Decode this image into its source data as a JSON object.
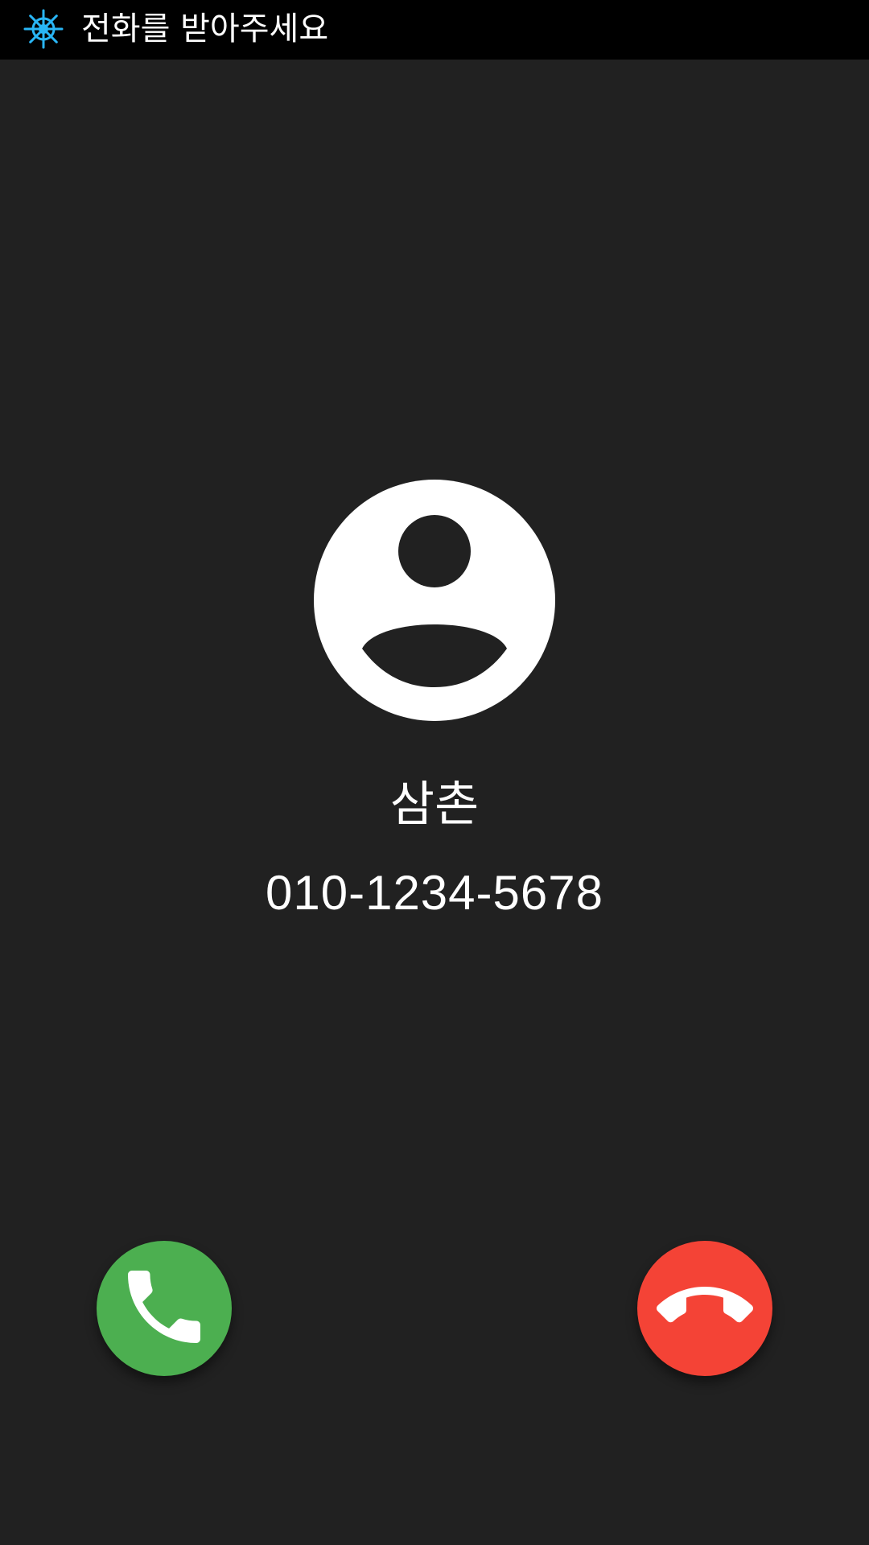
{
  "app": {
    "title": "전화를 받아주세요",
    "icon": "ship-wheel-icon",
    "icon_color": "#29b6f6"
  },
  "caller": {
    "name": "삼촌",
    "number": "010-1234-5678",
    "avatar_icon": "account-circle-icon"
  },
  "actions": {
    "accept": {
      "icon": "phone-icon",
      "color": "#4caf50"
    },
    "decline": {
      "icon": "call-end-icon",
      "color": "#f44336"
    }
  },
  "colors": {
    "background": "#212121",
    "title_bar": "#000000",
    "text": "#ffffff"
  }
}
